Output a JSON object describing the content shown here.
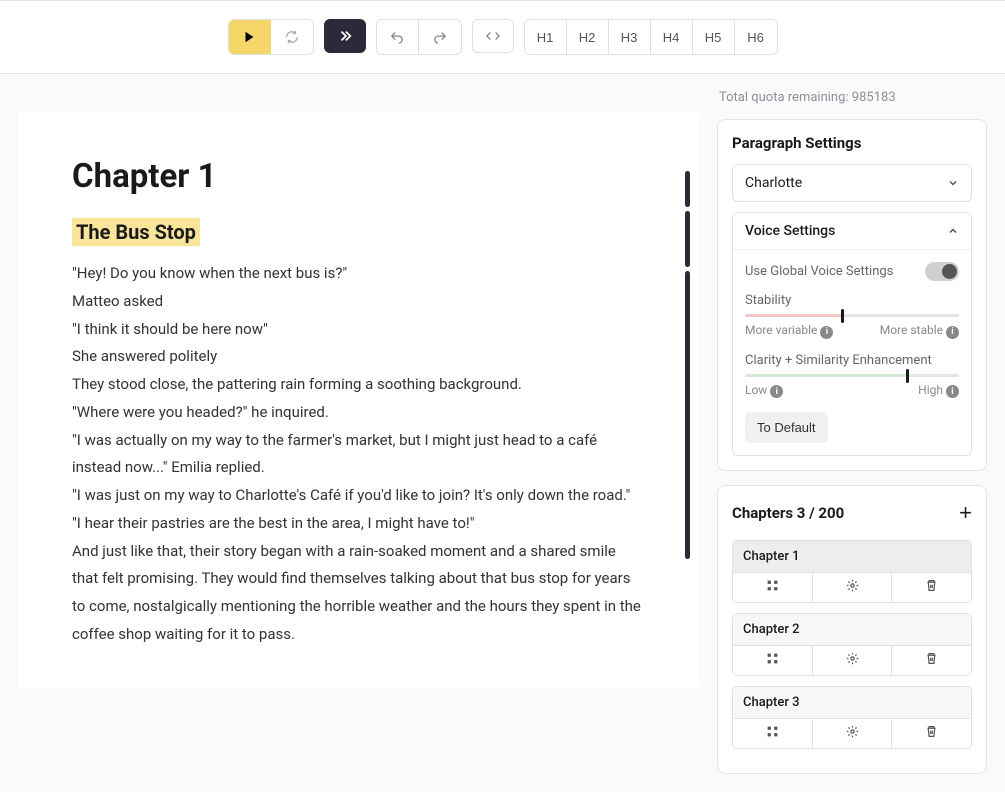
{
  "toolbar": {
    "h1": "H1",
    "h2": "H2",
    "h3": "H3",
    "h4": "H4",
    "h5": "H5",
    "h6": "H6"
  },
  "quota": {
    "label": "Total quota remaining:",
    "value": "985183"
  },
  "editor": {
    "chapter_heading": "Chapter 1",
    "subtitle": "The Bus Stop",
    "paragraphs": [
      "\"Hey! Do you know when the next bus is?\"",
      "Matteo asked",
      "\"I think it should be here now\"",
      "She answered politely",
      "They stood close, the pattering rain forming a soothing background.",
      "\"Where were you headed?\" he inquired.",
      "\"I was actually on my way to the farmer's market, but I might just head to a café instead now...\" Emilia replied.",
      "\"I was just on my way to Charlotte's Café if you'd like to join? It's only down the road.\"",
      "\"I hear their pastries are the best in the area, I might have to!\"",
      " And just like that, their story began with a rain-soaked moment and a shared smile that felt promising. They would find themselves talking about that bus stop for years to come, nostalgically mentioning the horrible weather and the hours they spent in the coffee shop waiting for it to pass."
    ]
  },
  "paragraph_settings": {
    "title": "Paragraph Settings",
    "voice_select": "Charlotte",
    "voice_settings_label": "Voice Settings",
    "global_toggle_label": "Use Global Voice Settings",
    "stability": {
      "label": "Stability",
      "left": "More variable",
      "right": "More stable",
      "value_percent": 45
    },
    "clarity": {
      "label": "Clarity + Similarity Enhancement",
      "left": "Low",
      "right": "High",
      "value_percent": 75
    },
    "default_btn": "To Default"
  },
  "chapters": {
    "title": "Chapters 3 / 200",
    "items": [
      {
        "label": "Chapter 1",
        "active": true
      },
      {
        "label": "Chapter 2",
        "active": false
      },
      {
        "label": "Chapter 3",
        "active": false
      }
    ]
  }
}
